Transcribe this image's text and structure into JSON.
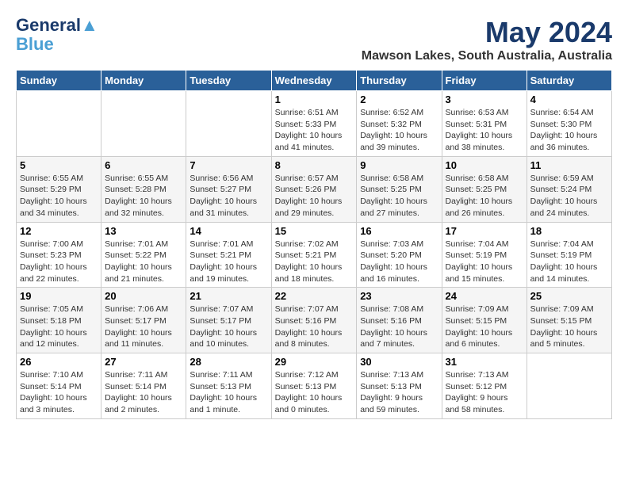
{
  "logo": {
    "line1": "General",
    "line2": "Blue"
  },
  "title": "May 2024",
  "location": "Mawson Lakes, South Australia, Australia",
  "days_of_week": [
    "Sunday",
    "Monday",
    "Tuesday",
    "Wednesday",
    "Thursday",
    "Friday",
    "Saturday"
  ],
  "weeks": [
    [
      {
        "day": "",
        "info": ""
      },
      {
        "day": "",
        "info": ""
      },
      {
        "day": "",
        "info": ""
      },
      {
        "day": "1",
        "info": "Sunrise: 6:51 AM\nSunset: 5:33 PM\nDaylight: 10 hours\nand 41 minutes."
      },
      {
        "day": "2",
        "info": "Sunrise: 6:52 AM\nSunset: 5:32 PM\nDaylight: 10 hours\nand 39 minutes."
      },
      {
        "day": "3",
        "info": "Sunrise: 6:53 AM\nSunset: 5:31 PM\nDaylight: 10 hours\nand 38 minutes."
      },
      {
        "day": "4",
        "info": "Sunrise: 6:54 AM\nSunset: 5:30 PM\nDaylight: 10 hours\nand 36 minutes."
      }
    ],
    [
      {
        "day": "5",
        "info": "Sunrise: 6:55 AM\nSunset: 5:29 PM\nDaylight: 10 hours\nand 34 minutes."
      },
      {
        "day": "6",
        "info": "Sunrise: 6:55 AM\nSunset: 5:28 PM\nDaylight: 10 hours\nand 32 minutes."
      },
      {
        "day": "7",
        "info": "Sunrise: 6:56 AM\nSunset: 5:27 PM\nDaylight: 10 hours\nand 31 minutes."
      },
      {
        "day": "8",
        "info": "Sunrise: 6:57 AM\nSunset: 5:26 PM\nDaylight: 10 hours\nand 29 minutes."
      },
      {
        "day": "9",
        "info": "Sunrise: 6:58 AM\nSunset: 5:25 PM\nDaylight: 10 hours\nand 27 minutes."
      },
      {
        "day": "10",
        "info": "Sunrise: 6:58 AM\nSunset: 5:25 PM\nDaylight: 10 hours\nand 26 minutes."
      },
      {
        "day": "11",
        "info": "Sunrise: 6:59 AM\nSunset: 5:24 PM\nDaylight: 10 hours\nand 24 minutes."
      }
    ],
    [
      {
        "day": "12",
        "info": "Sunrise: 7:00 AM\nSunset: 5:23 PM\nDaylight: 10 hours\nand 22 minutes."
      },
      {
        "day": "13",
        "info": "Sunrise: 7:01 AM\nSunset: 5:22 PM\nDaylight: 10 hours\nand 21 minutes."
      },
      {
        "day": "14",
        "info": "Sunrise: 7:01 AM\nSunset: 5:21 PM\nDaylight: 10 hours\nand 19 minutes."
      },
      {
        "day": "15",
        "info": "Sunrise: 7:02 AM\nSunset: 5:21 PM\nDaylight: 10 hours\nand 18 minutes."
      },
      {
        "day": "16",
        "info": "Sunrise: 7:03 AM\nSunset: 5:20 PM\nDaylight: 10 hours\nand 16 minutes."
      },
      {
        "day": "17",
        "info": "Sunrise: 7:04 AM\nSunset: 5:19 PM\nDaylight: 10 hours\nand 15 minutes."
      },
      {
        "day": "18",
        "info": "Sunrise: 7:04 AM\nSunset: 5:19 PM\nDaylight: 10 hours\nand 14 minutes."
      }
    ],
    [
      {
        "day": "19",
        "info": "Sunrise: 7:05 AM\nSunset: 5:18 PM\nDaylight: 10 hours\nand 12 minutes."
      },
      {
        "day": "20",
        "info": "Sunrise: 7:06 AM\nSunset: 5:17 PM\nDaylight: 10 hours\nand 11 minutes."
      },
      {
        "day": "21",
        "info": "Sunrise: 7:07 AM\nSunset: 5:17 PM\nDaylight: 10 hours\nand 10 minutes."
      },
      {
        "day": "22",
        "info": "Sunrise: 7:07 AM\nSunset: 5:16 PM\nDaylight: 10 hours\nand 8 minutes."
      },
      {
        "day": "23",
        "info": "Sunrise: 7:08 AM\nSunset: 5:16 PM\nDaylight: 10 hours\nand 7 minutes."
      },
      {
        "day": "24",
        "info": "Sunrise: 7:09 AM\nSunset: 5:15 PM\nDaylight: 10 hours\nand 6 minutes."
      },
      {
        "day": "25",
        "info": "Sunrise: 7:09 AM\nSunset: 5:15 PM\nDaylight: 10 hours\nand 5 minutes."
      }
    ],
    [
      {
        "day": "26",
        "info": "Sunrise: 7:10 AM\nSunset: 5:14 PM\nDaylight: 10 hours\nand 3 minutes."
      },
      {
        "day": "27",
        "info": "Sunrise: 7:11 AM\nSunset: 5:14 PM\nDaylight: 10 hours\nand 2 minutes."
      },
      {
        "day": "28",
        "info": "Sunrise: 7:11 AM\nSunset: 5:13 PM\nDaylight: 10 hours\nand 1 minute."
      },
      {
        "day": "29",
        "info": "Sunrise: 7:12 AM\nSunset: 5:13 PM\nDaylight: 10 hours\nand 0 minutes."
      },
      {
        "day": "30",
        "info": "Sunrise: 7:13 AM\nSunset: 5:13 PM\nDaylight: 9 hours\nand 59 minutes."
      },
      {
        "day": "31",
        "info": "Sunrise: 7:13 AM\nSunset: 5:12 PM\nDaylight: 9 hours\nand 58 minutes."
      },
      {
        "day": "",
        "info": ""
      }
    ]
  ]
}
